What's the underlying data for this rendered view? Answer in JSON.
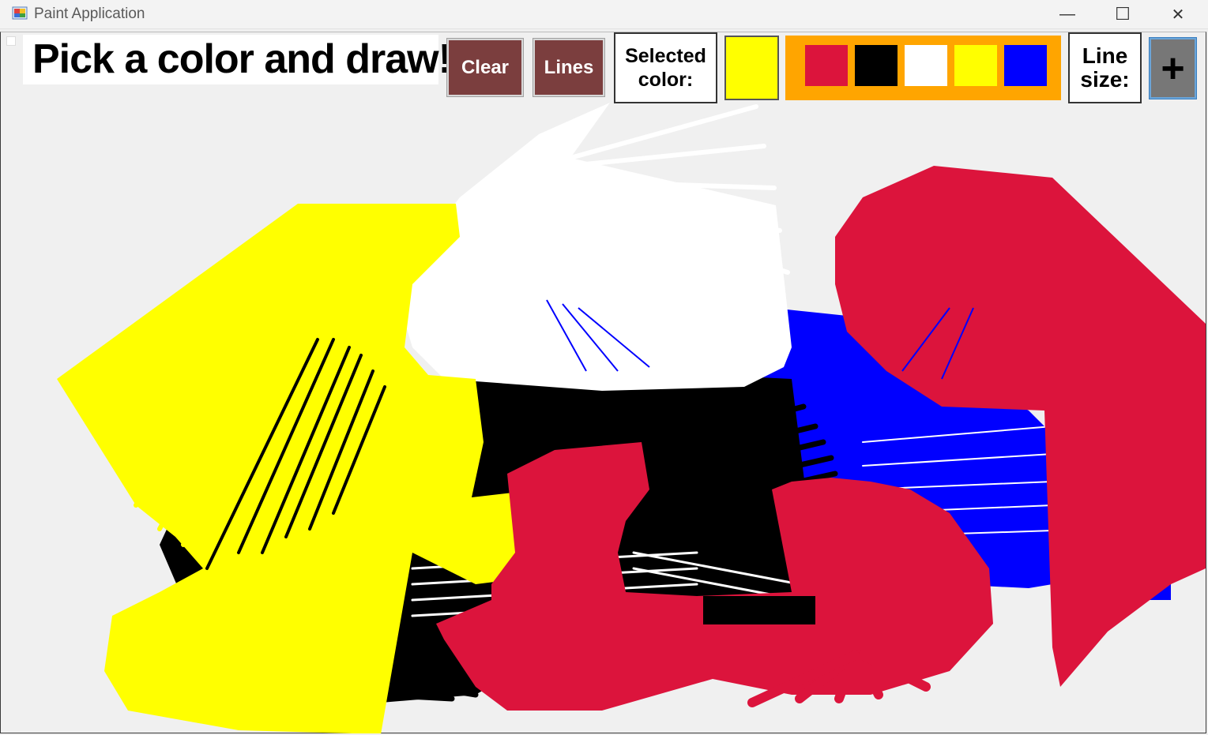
{
  "window": {
    "title": "Paint Application",
    "minimize_glyph": "—",
    "maximize_glyph": "☐",
    "close_glyph": "✕"
  },
  "toolbar": {
    "headline": "Pick a color and draw!",
    "clear_label": "Clear",
    "lines_label": "Lines",
    "selected_color_label": "Selected color:",
    "selected_color": "#ffff00",
    "palette_colors": [
      "#dc143c",
      "#000000",
      "#ffffff",
      "#ffff00",
      "#0000ff"
    ],
    "line_size_label": "Line size:",
    "plus_label": "+"
  },
  "colors": {
    "red": "#dc143c",
    "yellow": "#ffff00",
    "blue": "#0000ff",
    "black": "#000000",
    "white": "#ffffff",
    "palette_border": "#ffa500",
    "button_bg": "#7b3e3e"
  },
  "icons": [
    "app-icon",
    "minimize-icon",
    "maximize-icon",
    "close-icon"
  ]
}
